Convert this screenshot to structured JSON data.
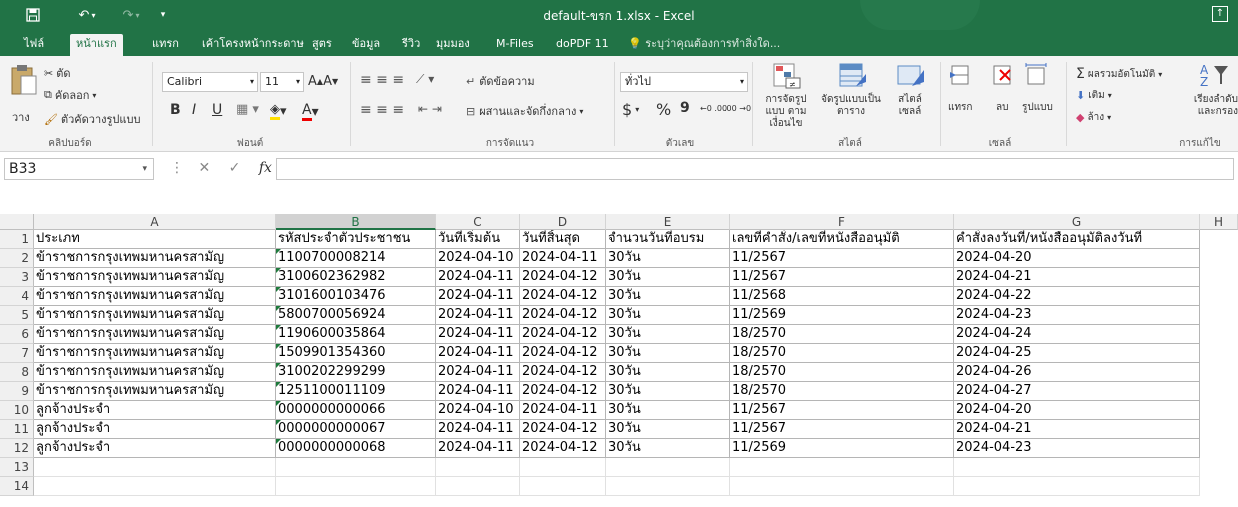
{
  "window": {
    "title": "default-ขรก 1.xlsx - Excel",
    "icons": {
      "save": "save-icon",
      "undo": "undo-icon",
      "redo": "redo-icon",
      "customize": "chevron-down-icon",
      "ribbon_options": "ribbon-display-options-icon"
    }
  },
  "tabs": [
    {
      "label": "ไฟล์",
      "active": false
    },
    {
      "label": "หน้าแรก",
      "active": true
    },
    {
      "label": "แทรก",
      "active": false
    },
    {
      "label": "เค้าโครงหน้ากระดาษ",
      "active": false
    },
    {
      "label": "สูตร",
      "active": false
    },
    {
      "label": "ข้อมูล",
      "active": false
    },
    {
      "label": "รีวิว",
      "active": false
    },
    {
      "label": "มุมมอง",
      "active": false
    },
    {
      "label": "M-Files",
      "active": false
    },
    {
      "label": "doPDF 11",
      "active": false
    }
  ],
  "tell_me": "ระบุว่าคุณต้องการทำสิ่งใด...",
  "ribbon": {
    "clipboard": {
      "paste": "วาง",
      "cut": "ตัด",
      "copy": "คัดลอก",
      "format_painter": "ตัวคัดวางรูปแบบ",
      "label": "คลิปบอร์ด"
    },
    "font": {
      "name": "Calibri",
      "size": "11",
      "bold": "B",
      "italic": "I",
      "underline": "U",
      "label": "ฟอนต์"
    },
    "alignment": {
      "wrap": "ตัดข้อความ",
      "merge": "ผสานและจัดกึ่งกลาง",
      "label": "การจัดแนว"
    },
    "number": {
      "format": "ทั่วไป",
      "currency": "$",
      "percent": "%",
      "comma": "9",
      "increase_decimal": "←0 .00",
      "decrease_decimal": ".00 →0",
      "label": "ตัวเลข"
    },
    "styles": {
      "conditional": "การจัดรูปแบบ ตามเงื่อนไข",
      "as_table": "จัดรูปแบบเป็น ตาราง",
      "cell_styles": "สไตล์ เซลล์",
      "label": "สไตล์"
    },
    "cells": {
      "insert": "แทรก",
      "delete": "ลบ",
      "format": "รูปแบบ",
      "label": "เซลล์"
    },
    "editing": {
      "autosum": "ผลรวมอัตโนมัติ",
      "fill": "เติม",
      "clear": "ล้าง",
      "sort_filter": "เรียงลำดับ และกรอง",
      "label": "การแก้ไข"
    }
  },
  "formula_bar": {
    "name_box": "B33",
    "fx": "fx",
    "value": ""
  },
  "columns": [
    "A",
    "B",
    "C",
    "D",
    "E",
    "F",
    "G",
    "H"
  ],
  "rows": [
    [
      "ประเภท",
      "รหัสประจำตัวประชาชน",
      "วันที่เริ่มต้น",
      "วันที่สิ้นสุด",
      "จำนวนวันที่อบรม",
      "เลขที่คำสั่ง/เลขที่หนังสืออนุมัติ",
      "คำสั่งลงวันที่/หนังสืออนุมัติลงวันที่"
    ],
    [
      "ข้าราชการกรุงเทพมหานครสามัญ",
      "1100700008214",
      "2024-04-10",
      "2024-04-11",
      "30วัน",
      "11/2567",
      "2024-04-20"
    ],
    [
      "ข้าราชการกรุงเทพมหานครสามัญ",
      "3100602362982",
      "2024-04-11",
      "2024-04-12",
      "30วัน",
      "11/2567",
      "2024-04-21"
    ],
    [
      "ข้าราชการกรุงเทพมหานครสามัญ",
      "3101600103476",
      "2024-04-11",
      "2024-04-12",
      "30วัน",
      "11/2568",
      "2024-04-22"
    ],
    [
      "ข้าราชการกรุงเทพมหานครสามัญ",
      "5800700056924",
      "2024-04-11",
      "2024-04-12",
      "30วัน",
      "11/2569",
      "2024-04-23"
    ],
    [
      "ข้าราชการกรุงเทพมหานครสามัญ",
      "1190600035864",
      "2024-04-11",
      "2024-04-12",
      "30วัน",
      "18/2570",
      "2024-04-24"
    ],
    [
      "ข้าราชการกรุงเทพมหานครสามัญ",
      "1509901354360",
      "2024-04-11",
      "2024-04-12",
      "30วัน",
      "18/2570",
      "2024-04-25"
    ],
    [
      "ข้าราชการกรุงเทพมหานครสามัญ",
      "3100202299299",
      "2024-04-11",
      "2024-04-12",
      "30วัน",
      "18/2570",
      "2024-04-26"
    ],
    [
      "ข้าราชการกรุงเทพมหานครสามัญ",
      "1251100011109",
      "2024-04-11",
      "2024-04-12",
      "30วัน",
      "18/2570",
      "2024-04-27"
    ],
    [
      "ลูกจ้างประจำ",
      "0000000000066",
      "2024-04-10",
      "2024-04-11",
      "30วัน",
      "11/2567",
      "2024-04-20"
    ],
    [
      "ลูกจ้างประจำ",
      "0000000000067",
      "2024-04-11",
      "2024-04-12",
      "30วัน",
      "11/2567",
      "2024-04-21"
    ],
    [
      "ลูกจ้างประจำ",
      "0000000000068",
      "2024-04-11",
      "2024-04-12",
      "30วัน",
      "11/2569",
      "2024-04-23"
    ],
    [],
    []
  ],
  "colors": {
    "excel_green": "#217346",
    "ribbon_bg": "#f3f3f3",
    "header_bg": "#f0f0f0"
  }
}
